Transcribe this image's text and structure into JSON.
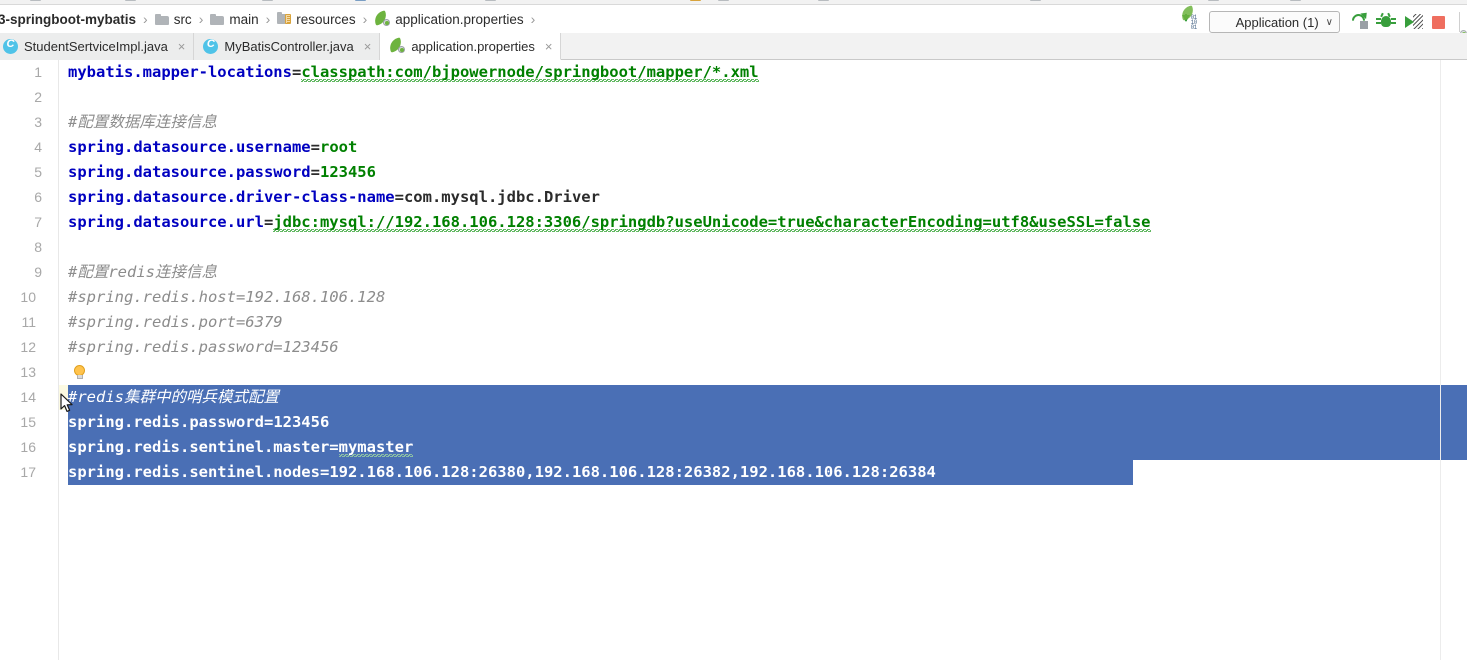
{
  "window": {
    "app": "IntelliJ IDEA",
    "file_type": "properties"
  },
  "toolbar": {
    "updown_icon": "sort-updown-icon",
    "bits_top": "01",
    "bits_mid": "10",
    "bits_bot": "01",
    "run_config_label": "Application (1)",
    "run_config_chevron": "∨",
    "rerun_icon": "rerun-icon",
    "debug_icon": "debug-bug-icon",
    "coverage_icon": "run-with-coverage-icon",
    "stop_icon": "stop-icon"
  },
  "breadcrumb": {
    "items": [
      {
        "label": "3-springboot-mybatis",
        "icon": "none",
        "bold": true
      },
      {
        "label": "src",
        "icon": "folder-icon",
        "bold": false
      },
      {
        "label": "main",
        "icon": "folder-icon",
        "bold": false
      },
      {
        "label": "resources",
        "icon": "resources-folder-icon",
        "bold": false
      },
      {
        "label": "application.properties",
        "icon": "spring-leaf-icon",
        "bold": false
      }
    ],
    "separator": "›"
  },
  "tabs": [
    {
      "label": "StudentSertviceImpl.java",
      "icon": "java-class-icon",
      "active": false,
      "close": "×"
    },
    {
      "label": "MyBatisController.java",
      "icon": "java-class-icon",
      "active": false,
      "close": "×"
    },
    {
      "label": "application.properties",
      "icon": "spring-leaf-icon",
      "active": true,
      "close": "×"
    }
  ],
  "editor": {
    "gutter_numbers": [
      "1",
      "2",
      "3",
      "4",
      "5",
      "6",
      "7",
      "8",
      "9",
      "10",
      "11",
      "12",
      "13",
      "14",
      "15",
      "16",
      "17"
    ],
    "caret_line": 14,
    "selection_lines": [
      14,
      15,
      16,
      17
    ],
    "lines": [
      {
        "n": 1,
        "type": "prop",
        "key": "mybatis.mapper-locations",
        "eq": "=",
        "value": "classpath:com/bjpowernode/springboot/mapper/*.xml",
        "value_typo": true
      },
      {
        "n": 2,
        "type": "blank",
        "text": ""
      },
      {
        "n": 3,
        "type": "comment",
        "text": "#配置数据库连接信息"
      },
      {
        "n": 4,
        "type": "prop",
        "key": "spring.datasource.username",
        "eq": "=",
        "value": "root"
      },
      {
        "n": 5,
        "type": "prop",
        "key": "spring.datasource.password",
        "eq": "=",
        "value": "123456"
      },
      {
        "n": 6,
        "type": "prop",
        "key": "spring.datasource.driver-class-name",
        "eq": "=",
        "value": "com.mysql.jdbc.Driver",
        "value_plain": true
      },
      {
        "n": 7,
        "type": "prop",
        "key": "spring.datasource.url",
        "eq": "=",
        "value": "jdbc:mysql://192.168.106.128:3306/springdb?useUnicode=true&characterEncoding=utf8&useSSL=false"
      },
      {
        "n": 8,
        "type": "blank",
        "text": ""
      },
      {
        "n": 9,
        "type": "comment",
        "text": "#配置redis连接信息"
      },
      {
        "n": 10,
        "type": "comment",
        "text": "#spring.redis.host=192.168.106.128"
      },
      {
        "n": 11,
        "type": "comment",
        "text": "#spring.redis.port=6379"
      },
      {
        "n": 12,
        "type": "comment",
        "text": "#spring.redis.password=123456"
      },
      {
        "n": 13,
        "type": "blank",
        "text": ""
      },
      {
        "n": 14,
        "type": "comment",
        "text": "#redis集群中的哨兵模式配置",
        "selected": true
      },
      {
        "n": 15,
        "type": "prop",
        "key": "spring.redis.password",
        "eq": "=",
        "value": "123456",
        "selected": true
      },
      {
        "n": 16,
        "type": "prop",
        "key": "spring.redis.sentinel.master",
        "eq": "=",
        "value": "mymaster",
        "value_typo": true,
        "selected": true
      },
      {
        "n": 17,
        "type": "prop",
        "key": "spring.redis.sentinel.nodes",
        "eq": "=",
        "value": "192.168.106.128:26380,192.168.106.128:26382,192.168.106.128:26384",
        "selected": true
      }
    ],
    "intention_bulb_icon": "lightbulb-icon",
    "mouse_cursor_icon": "mouse-pointer-icon"
  },
  "colors": {
    "key": "#0000c0",
    "value": "#008000",
    "comment": "#8c8c8c",
    "selection": "#4a6fb5",
    "caret_line": "#fcfae2",
    "spring_green": "#6db33f",
    "run_green": "#389e3c",
    "stop_red": "#ef6e5f"
  }
}
